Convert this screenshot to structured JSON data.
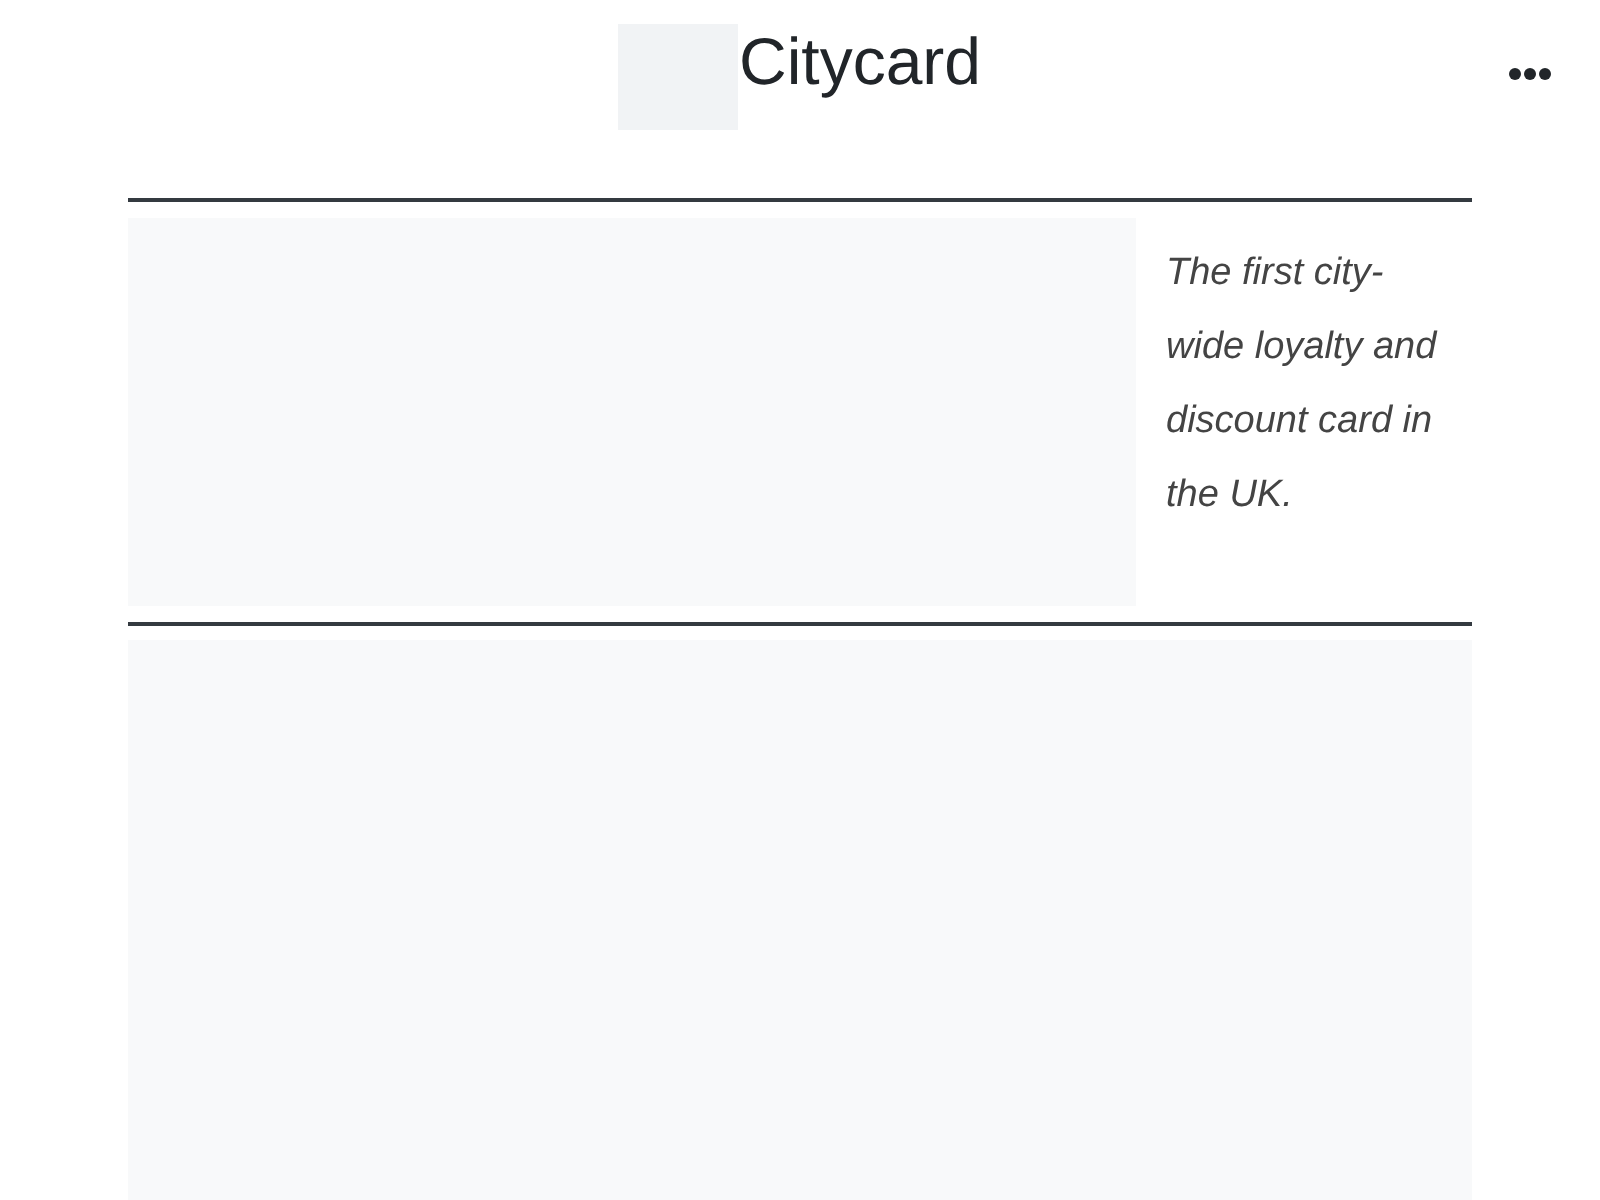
{
  "header": {
    "title": "Citycard"
  },
  "intro": {
    "text": "The first city-wide loyalty and discount card in the UK."
  }
}
